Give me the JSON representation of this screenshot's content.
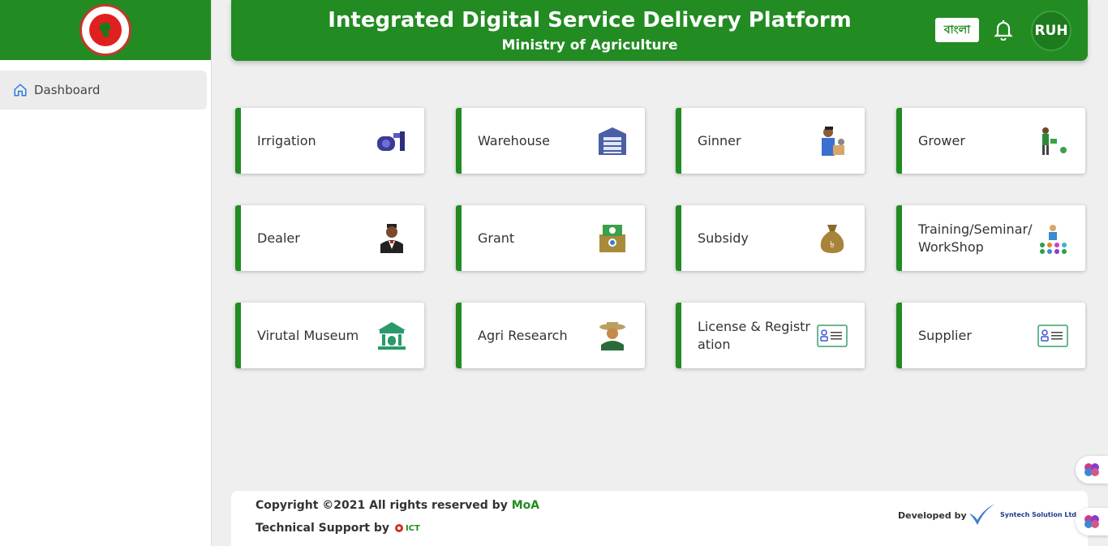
{
  "header": {
    "title": "Integrated Digital Service Delivery Platform",
    "subtitle": "Ministry of Agriculture",
    "lang_button": "বাংলা",
    "user_initials": "RUH"
  },
  "sidebar": {
    "items": [
      {
        "label": "Dashboard",
        "icon": "home-icon"
      }
    ]
  },
  "cards": [
    {
      "label": "Irrigation",
      "icon": "water-pump-icon"
    },
    {
      "label": "Warehouse",
      "icon": "warehouse-icon"
    },
    {
      "label": "Ginner",
      "icon": "ginner-worker-icon"
    },
    {
      "label": "Grower",
      "icon": "watering-plant-icon"
    },
    {
      "label": "Dealer",
      "icon": "dealer-person-icon"
    },
    {
      "label": "Grant",
      "icon": "grant-money-icon"
    },
    {
      "label": "Subsidy",
      "icon": "money-bag-icon"
    },
    {
      "label": "Training/Seminar/WorkShop",
      "icon": "training-group-icon"
    },
    {
      "label": "Virutal Museum",
      "icon": "museum-icon"
    },
    {
      "label": "Agri Research",
      "icon": "farmer-icon"
    },
    {
      "label": "License & Registration",
      "icon": "id-card-icon"
    },
    {
      "label": "Supplier",
      "icon": "id-card-icon"
    }
  ],
  "footer": {
    "copyright_prefix": "Copyright ©2021 All rights reserved by ",
    "copyright_brand": "MoA",
    "support_label": "Technical Support by",
    "support_logo_text": "ICT",
    "developed_by": "Developed by",
    "developer_name": "Syntech Solution Ltd."
  },
  "colors": {
    "primary": "#228b22",
    "card_border": "#228b22"
  }
}
